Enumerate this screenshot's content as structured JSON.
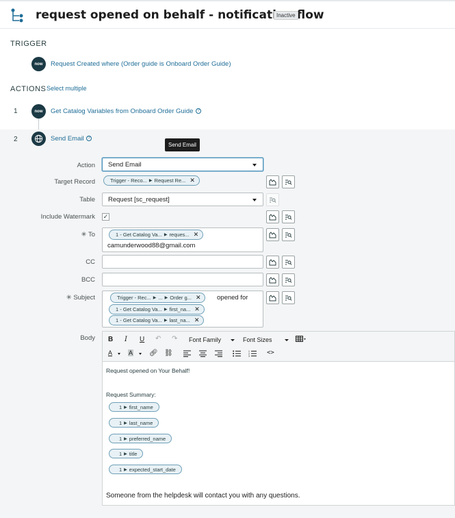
{
  "header": {
    "title": "request opened on behalf - notification flow",
    "status_badge": "Inactive"
  },
  "trigger": {
    "section_label": "TRIGGER",
    "badge_text": "now",
    "text": "Request Created where (Order guide is Onboard Order Guide)"
  },
  "actions": {
    "section_label": "ACTIONS",
    "select_multiple": "Select multiple",
    "items": [
      {
        "number": "1",
        "badge_text": "now",
        "label": "Get Catalog Variables from Onboard Order Guide"
      },
      {
        "number": "2",
        "label": "Send Email"
      }
    ]
  },
  "tooltip": "Send Email",
  "form": {
    "action": {
      "label": "Action",
      "value": "Send Email"
    },
    "target_record": {
      "label": "Target Record",
      "pill_left": "Trigger - Reco...",
      "pill_right": "Request Re..."
    },
    "table": {
      "label": "Table",
      "value": "Request [sc_request]"
    },
    "include_watermark": {
      "label": "Include Watermark",
      "checked": "✓"
    },
    "to": {
      "label": "To",
      "required_mark": "✳",
      "pill_left": "1 - Get Catalog Va...",
      "pill_right": "reques...",
      "text": "camunderwood88@gmail.com"
    },
    "cc": {
      "label": "CC"
    },
    "bcc": {
      "label": "BCC"
    },
    "subject": {
      "label": "Subject",
      "required_mark": "✳",
      "pills": [
        {
          "left": "Trigger - Rec...",
          "mid": "...",
          "right": "Order g..."
        },
        {
          "left": "1 - Get Catalog Va...",
          "right": "first_na..."
        },
        {
          "left": "1 - Get Catalog Va...",
          "right": "last_na..."
        }
      ],
      "text": "opened for"
    },
    "body": {
      "label": "Body",
      "toolbar": {
        "font_family": "Font Family",
        "font_sizes": "Font Sizes"
      },
      "intro": "Request opened on Your Behalf!",
      "summary_label": "Request Summary:",
      "chips": [
        {
          "num": "1",
          "label": "first_name"
        },
        {
          "num": "1",
          "label": "last_name"
        },
        {
          "num": "1",
          "label": "preferred_name"
        },
        {
          "num": "1",
          "label": "title"
        },
        {
          "num": "1",
          "label": "expected_start_date"
        }
      ],
      "closing": "Someone from the helpdesk will contact you with any questions."
    }
  }
}
